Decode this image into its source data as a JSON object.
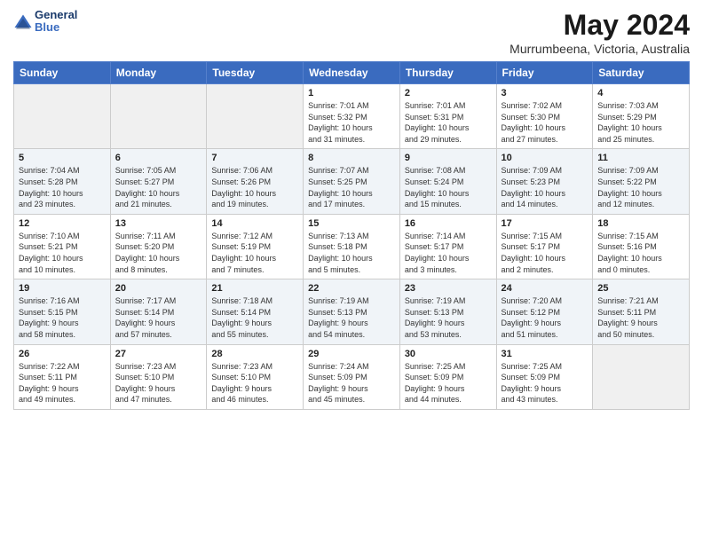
{
  "header": {
    "logo_line1": "General",
    "logo_line2": "Blue",
    "title": "May 2024",
    "subtitle": "Murrumbeena, Victoria, Australia"
  },
  "weekdays": [
    "Sunday",
    "Monday",
    "Tuesday",
    "Wednesday",
    "Thursday",
    "Friday",
    "Saturday"
  ],
  "weeks": [
    [
      {
        "day": "",
        "info": ""
      },
      {
        "day": "",
        "info": ""
      },
      {
        "day": "",
        "info": ""
      },
      {
        "day": "1",
        "info": "Sunrise: 7:01 AM\nSunset: 5:32 PM\nDaylight: 10 hours\nand 31 minutes."
      },
      {
        "day": "2",
        "info": "Sunrise: 7:01 AM\nSunset: 5:31 PM\nDaylight: 10 hours\nand 29 minutes."
      },
      {
        "day": "3",
        "info": "Sunrise: 7:02 AM\nSunset: 5:30 PM\nDaylight: 10 hours\nand 27 minutes."
      },
      {
        "day": "4",
        "info": "Sunrise: 7:03 AM\nSunset: 5:29 PM\nDaylight: 10 hours\nand 25 minutes."
      }
    ],
    [
      {
        "day": "5",
        "info": "Sunrise: 7:04 AM\nSunset: 5:28 PM\nDaylight: 10 hours\nand 23 minutes."
      },
      {
        "day": "6",
        "info": "Sunrise: 7:05 AM\nSunset: 5:27 PM\nDaylight: 10 hours\nand 21 minutes."
      },
      {
        "day": "7",
        "info": "Sunrise: 7:06 AM\nSunset: 5:26 PM\nDaylight: 10 hours\nand 19 minutes."
      },
      {
        "day": "8",
        "info": "Sunrise: 7:07 AM\nSunset: 5:25 PM\nDaylight: 10 hours\nand 17 minutes."
      },
      {
        "day": "9",
        "info": "Sunrise: 7:08 AM\nSunset: 5:24 PM\nDaylight: 10 hours\nand 15 minutes."
      },
      {
        "day": "10",
        "info": "Sunrise: 7:09 AM\nSunset: 5:23 PM\nDaylight: 10 hours\nand 14 minutes."
      },
      {
        "day": "11",
        "info": "Sunrise: 7:09 AM\nSunset: 5:22 PM\nDaylight: 10 hours\nand 12 minutes."
      }
    ],
    [
      {
        "day": "12",
        "info": "Sunrise: 7:10 AM\nSunset: 5:21 PM\nDaylight: 10 hours\nand 10 minutes."
      },
      {
        "day": "13",
        "info": "Sunrise: 7:11 AM\nSunset: 5:20 PM\nDaylight: 10 hours\nand 8 minutes."
      },
      {
        "day": "14",
        "info": "Sunrise: 7:12 AM\nSunset: 5:19 PM\nDaylight: 10 hours\nand 7 minutes."
      },
      {
        "day": "15",
        "info": "Sunrise: 7:13 AM\nSunset: 5:18 PM\nDaylight: 10 hours\nand 5 minutes."
      },
      {
        "day": "16",
        "info": "Sunrise: 7:14 AM\nSunset: 5:17 PM\nDaylight: 10 hours\nand 3 minutes."
      },
      {
        "day": "17",
        "info": "Sunrise: 7:15 AM\nSunset: 5:17 PM\nDaylight: 10 hours\nand 2 minutes."
      },
      {
        "day": "18",
        "info": "Sunrise: 7:15 AM\nSunset: 5:16 PM\nDaylight: 10 hours\nand 0 minutes."
      }
    ],
    [
      {
        "day": "19",
        "info": "Sunrise: 7:16 AM\nSunset: 5:15 PM\nDaylight: 9 hours\nand 58 minutes."
      },
      {
        "day": "20",
        "info": "Sunrise: 7:17 AM\nSunset: 5:14 PM\nDaylight: 9 hours\nand 57 minutes."
      },
      {
        "day": "21",
        "info": "Sunrise: 7:18 AM\nSunset: 5:14 PM\nDaylight: 9 hours\nand 55 minutes."
      },
      {
        "day": "22",
        "info": "Sunrise: 7:19 AM\nSunset: 5:13 PM\nDaylight: 9 hours\nand 54 minutes."
      },
      {
        "day": "23",
        "info": "Sunrise: 7:19 AM\nSunset: 5:13 PM\nDaylight: 9 hours\nand 53 minutes."
      },
      {
        "day": "24",
        "info": "Sunrise: 7:20 AM\nSunset: 5:12 PM\nDaylight: 9 hours\nand 51 minutes."
      },
      {
        "day": "25",
        "info": "Sunrise: 7:21 AM\nSunset: 5:11 PM\nDaylight: 9 hours\nand 50 minutes."
      }
    ],
    [
      {
        "day": "26",
        "info": "Sunrise: 7:22 AM\nSunset: 5:11 PM\nDaylight: 9 hours\nand 49 minutes."
      },
      {
        "day": "27",
        "info": "Sunrise: 7:23 AM\nSunset: 5:10 PM\nDaylight: 9 hours\nand 47 minutes."
      },
      {
        "day": "28",
        "info": "Sunrise: 7:23 AM\nSunset: 5:10 PM\nDaylight: 9 hours\nand 46 minutes."
      },
      {
        "day": "29",
        "info": "Sunrise: 7:24 AM\nSunset: 5:09 PM\nDaylight: 9 hours\nand 45 minutes."
      },
      {
        "day": "30",
        "info": "Sunrise: 7:25 AM\nSunset: 5:09 PM\nDaylight: 9 hours\nand 44 minutes."
      },
      {
        "day": "31",
        "info": "Sunrise: 7:25 AM\nSunset: 5:09 PM\nDaylight: 9 hours\nand 43 minutes."
      },
      {
        "day": "",
        "info": ""
      }
    ]
  ]
}
